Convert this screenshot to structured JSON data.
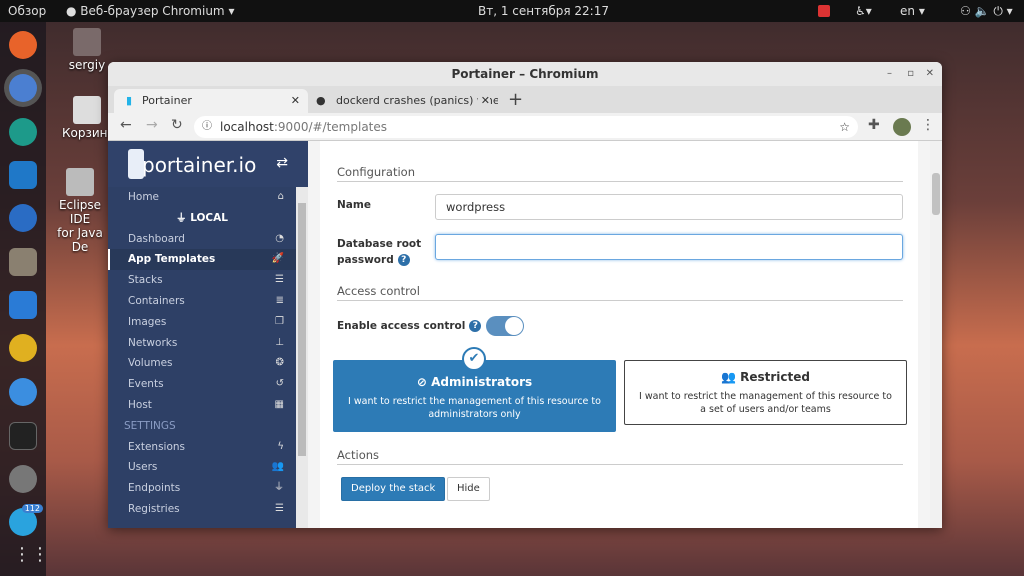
{
  "topbar": {
    "activities": "Обзор",
    "app": "Веб-браузер Chromium",
    "clock": "Вт, 1 сентября  22:17",
    "lang": "en"
  },
  "desktop": {
    "home": "sergiy",
    "trash": "Корзина",
    "eclipse_line1": "Eclipse IDE",
    "eclipse_line2": "for Java De"
  },
  "dock": {
    "badge": "112"
  },
  "window": {
    "title": "Portainer – Chromium"
  },
  "tabs": [
    {
      "label": "Portainer"
    },
    {
      "label": "dockerd crashes (panics) whe"
    }
  ],
  "address": {
    "host": "localhost",
    "path": ":9000/#/templates"
  },
  "sidebar": {
    "logo": "portainer.io",
    "endpoint": "LOCAL",
    "settings_header": "SETTINGS",
    "items": [
      {
        "label": "Home",
        "icon": "⌂"
      },
      {
        "label": "Dashboard",
        "icon": "◔"
      },
      {
        "label": "App Templates",
        "icon": "🚀"
      },
      {
        "label": "Stacks",
        "icon": "☰"
      },
      {
        "label": "Containers",
        "icon": "≣"
      },
      {
        "label": "Images",
        "icon": "❐"
      },
      {
        "label": "Networks",
        "icon": "⊥"
      },
      {
        "label": "Volumes",
        "icon": "❂"
      },
      {
        "label": "Events",
        "icon": "↺"
      },
      {
        "label": "Host",
        "icon": "▦"
      }
    ],
    "settings": [
      {
        "label": "Extensions",
        "icon": "ϟ"
      },
      {
        "label": "Users",
        "icon": "👥"
      },
      {
        "label": "Endpoints",
        "icon": "⏚"
      },
      {
        "label": "Registries",
        "icon": "☰"
      }
    ]
  },
  "form": {
    "configuration": "Configuration",
    "name_label": "Name",
    "name_value": "wordpress",
    "db_label1": "Database root",
    "db_label2": "password",
    "db_value": "",
    "access_control": "Access control",
    "enable_label": "Enable access control",
    "enabled": true,
    "admin_title": "Administrators",
    "admin_desc": "I want to restrict the management of this resource to administrators only",
    "restricted_title": "Restricted",
    "restricted_desc": "I want to restrict the management of this resource to a set of users and/or teams",
    "actions": "Actions",
    "deploy": "Deploy the stack",
    "hide": "Hide"
  },
  "colors": {
    "sidebar": "#30426a",
    "primary": "#2d7bb6"
  }
}
